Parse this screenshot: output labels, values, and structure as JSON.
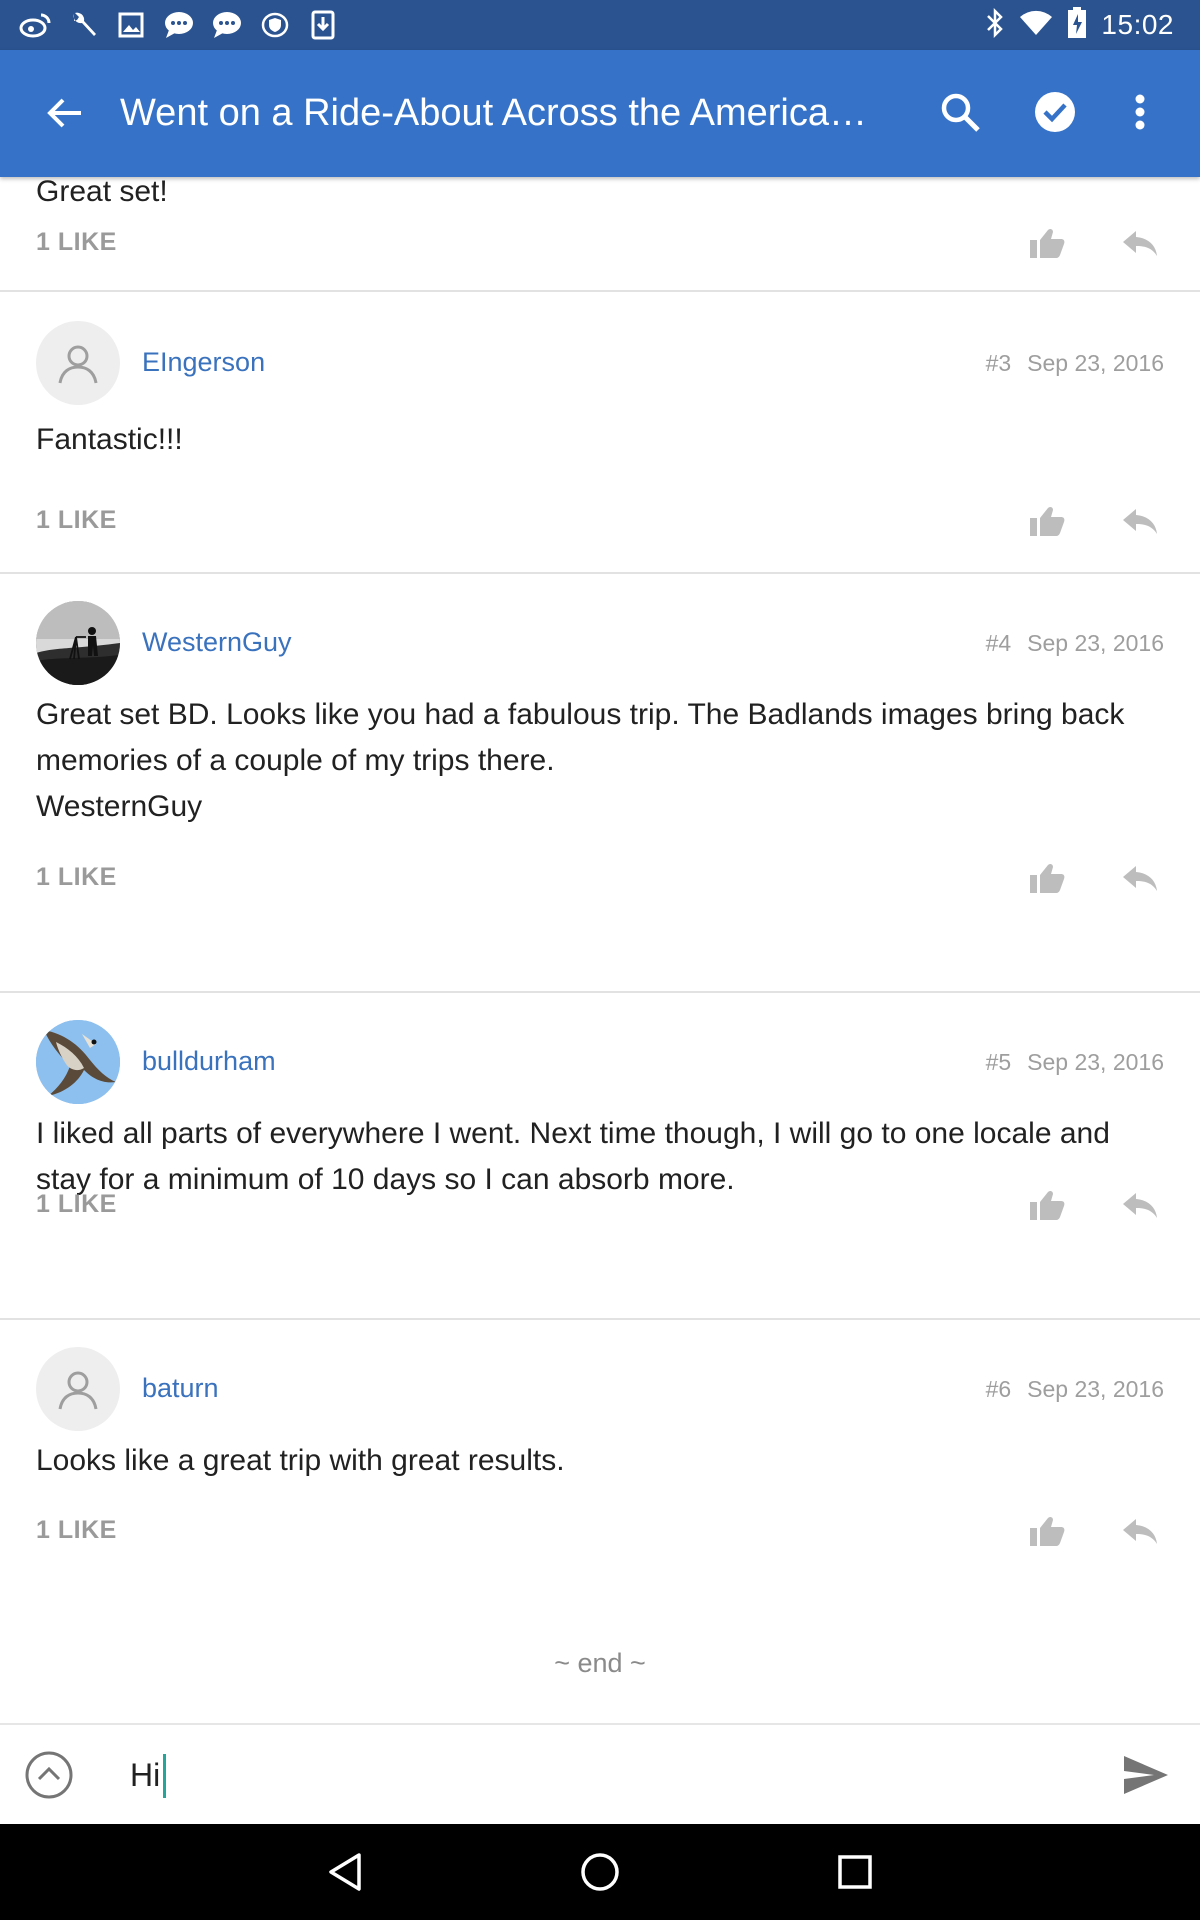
{
  "status_bar": {
    "time": "15:02",
    "left_icons": [
      "weibo-icon",
      "wrench-icon",
      "image-icon",
      "chat-bubble-icon",
      "chat-bubble-icon",
      "shield-icon",
      "download-icon"
    ],
    "right_icons": [
      "bluetooth-icon",
      "wifi-icon",
      "battery-charging-icon"
    ]
  },
  "app_bar": {
    "title": "Went on a Ride-About Across the America…",
    "icons": [
      "back-arrow-icon",
      "search-icon",
      "check-circle-icon",
      "more-vert-icon"
    ]
  },
  "posts": [
    {
      "body": [
        "Great set!"
      ],
      "likes": "1 LIKE"
    },
    {
      "username": "EIngerson",
      "number": "#3",
      "date": "Sep 23, 2016",
      "avatar": "default-avatar",
      "body": [
        "Fantastic!!!"
      ],
      "likes": "1 LIKE"
    },
    {
      "username": "WesternGuy",
      "number": "#4",
      "date": "Sep 23, 2016",
      "avatar": "photographer-avatar",
      "body": [
        "Great set BD. Looks like you had a fabulous trip. The Badlands images bring back memories of a couple of my trips there.",
        "WesternGuy"
      ],
      "likes": "1 LIKE"
    },
    {
      "username": "bulldurham",
      "number": "#5",
      "date": "Sep 23, 2016",
      "avatar": "bird-avatar",
      "body": [
        "I liked all parts of everywhere I went. Next time though, I will go to one locale and stay for a minimum of 10 days so I can absorb more."
      ],
      "likes": "1 LIKE"
    },
    {
      "username": "baturn",
      "number": "#6",
      "date": "Sep 23, 2016",
      "avatar": "default-avatar",
      "body": [
        "Looks like a great trip with great results."
      ],
      "likes": "1 LIKE"
    }
  ],
  "end_marker": "~ end ~",
  "composer": {
    "value": "Hi",
    "icons": [
      "expand-up-icon",
      "send-icon"
    ]
  },
  "nav_bar": {
    "icons": [
      "nav-back-icon",
      "nav-home-icon",
      "nav-recents-icon"
    ]
  },
  "colors": {
    "status_bar": "#2a5390",
    "app_bar": "#3673c8",
    "username": "#3a72bd",
    "caret": "#26a69a"
  }
}
